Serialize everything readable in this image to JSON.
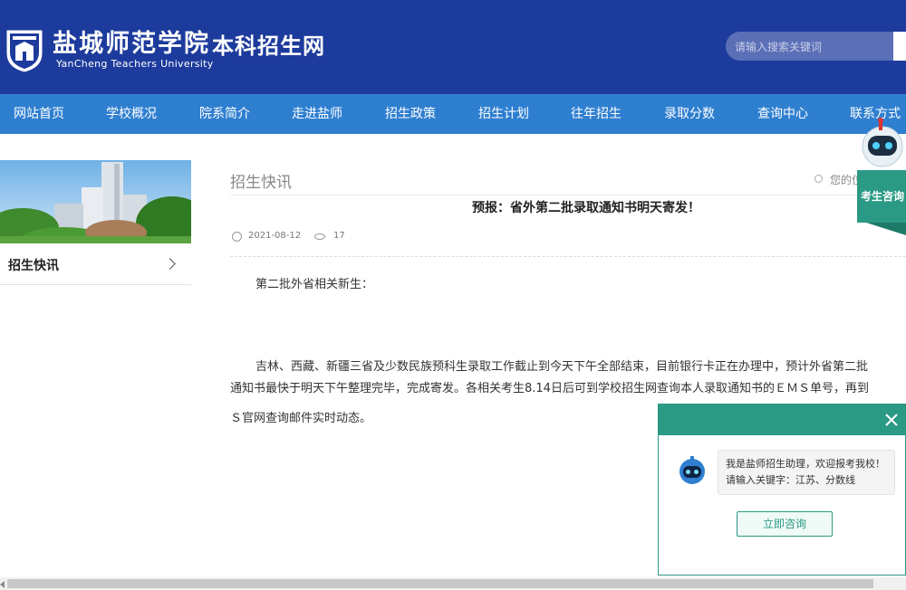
{
  "header": {
    "school_name_cn": "盐城师范学院",
    "site_name": "本科招生网",
    "school_name_en": "YanCheng Teachers University",
    "search_placeholder": "请输入搜索关键词",
    "brand_color": "#1d3b9c"
  },
  "nav": {
    "items": [
      "网站首页",
      "学校概况",
      "院系简介",
      "走进盐师",
      "招生政策",
      "招生计划",
      "往年招生",
      "录取分数",
      "查询中心",
      "联系方式"
    ],
    "color": "#2f7fd0"
  },
  "sidebar": {
    "items": [
      {
        "label": "招生快讯",
        "icon": "chevron-right-icon"
      }
    ]
  },
  "main": {
    "section_title": "招生快讯",
    "location_label": "您的位置",
    "article": {
      "title": "预报：省外第二批录取通知书明天寄发！",
      "date": "2021-08-12",
      "views": "17",
      "paragraphs": [
        "第二批外省相关新生：",
        "吉林、西藏、新疆三省及少数民族预科生录取工作截止到今天下午全部结束，目前银行卡正在办理中，预计外省第二批",
        "通知书最快于明天下午整理完毕，完成寄发。各相关考生8.14日后可到学校招生网查询本人录取通知书的ＥＭＳ单号，再到",
        "Ｓ官网查询邮件实时动态。"
      ]
    }
  },
  "consult": {
    "tab_label": "考生咨询",
    "greeting": "我是盐师招生助理，欢迎报考我校！请输入关键字：江苏、分数线",
    "button_label": "立即咨询",
    "accent_color": "#2a9a84"
  }
}
